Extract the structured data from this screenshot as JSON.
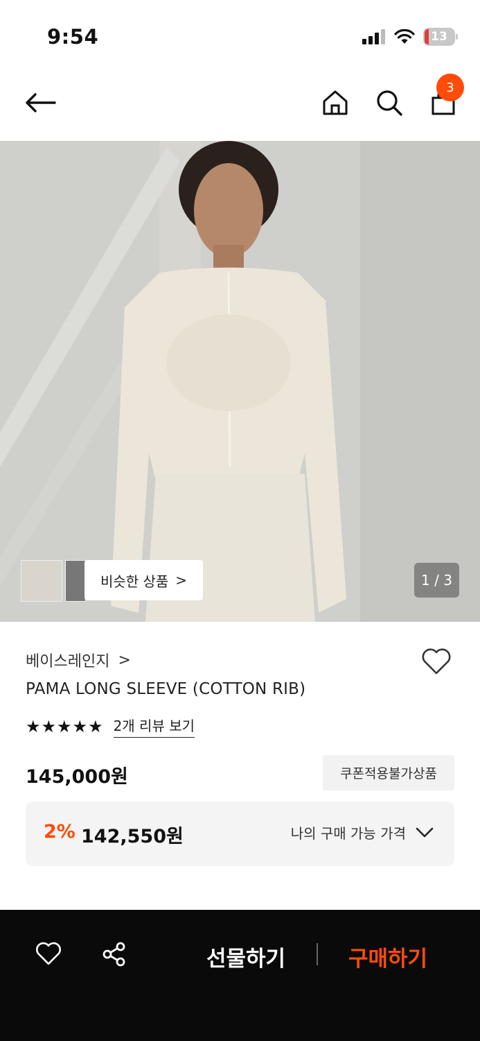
{
  "status_bar": {
    "time": "9:54",
    "battery": "13"
  },
  "top_nav": {
    "cart_count": "3"
  },
  "gallery": {
    "similar_label": "비슷한 상품",
    "chevron": ">",
    "pager": "1 / 3"
  },
  "product": {
    "brand": "베이스레인지",
    "brand_chevron": ">",
    "name": "PAMA LONG SLEEVE (COTTON RIB)",
    "stars": "★★★★★",
    "review_link": "2개 리뷰 보기",
    "price": "145,000원",
    "coupon_note": "쿠폰적용불가상품",
    "discount_rate": "2%",
    "discount_price": "142,550원",
    "my_price_label": "나의 구매 가능 가격"
  },
  "bottom_bar": {
    "gift_label": "선물하기",
    "buy_label": "구매하기"
  },
  "colors": {
    "accent": "#ff4c0a",
    "bottom_bar_bg": "#0a0a0a"
  },
  "icons": [
    "back-arrow-icon",
    "home-icon",
    "search-icon",
    "cart-icon",
    "heart-icon",
    "share-icon",
    "chevron-down-icon"
  ]
}
